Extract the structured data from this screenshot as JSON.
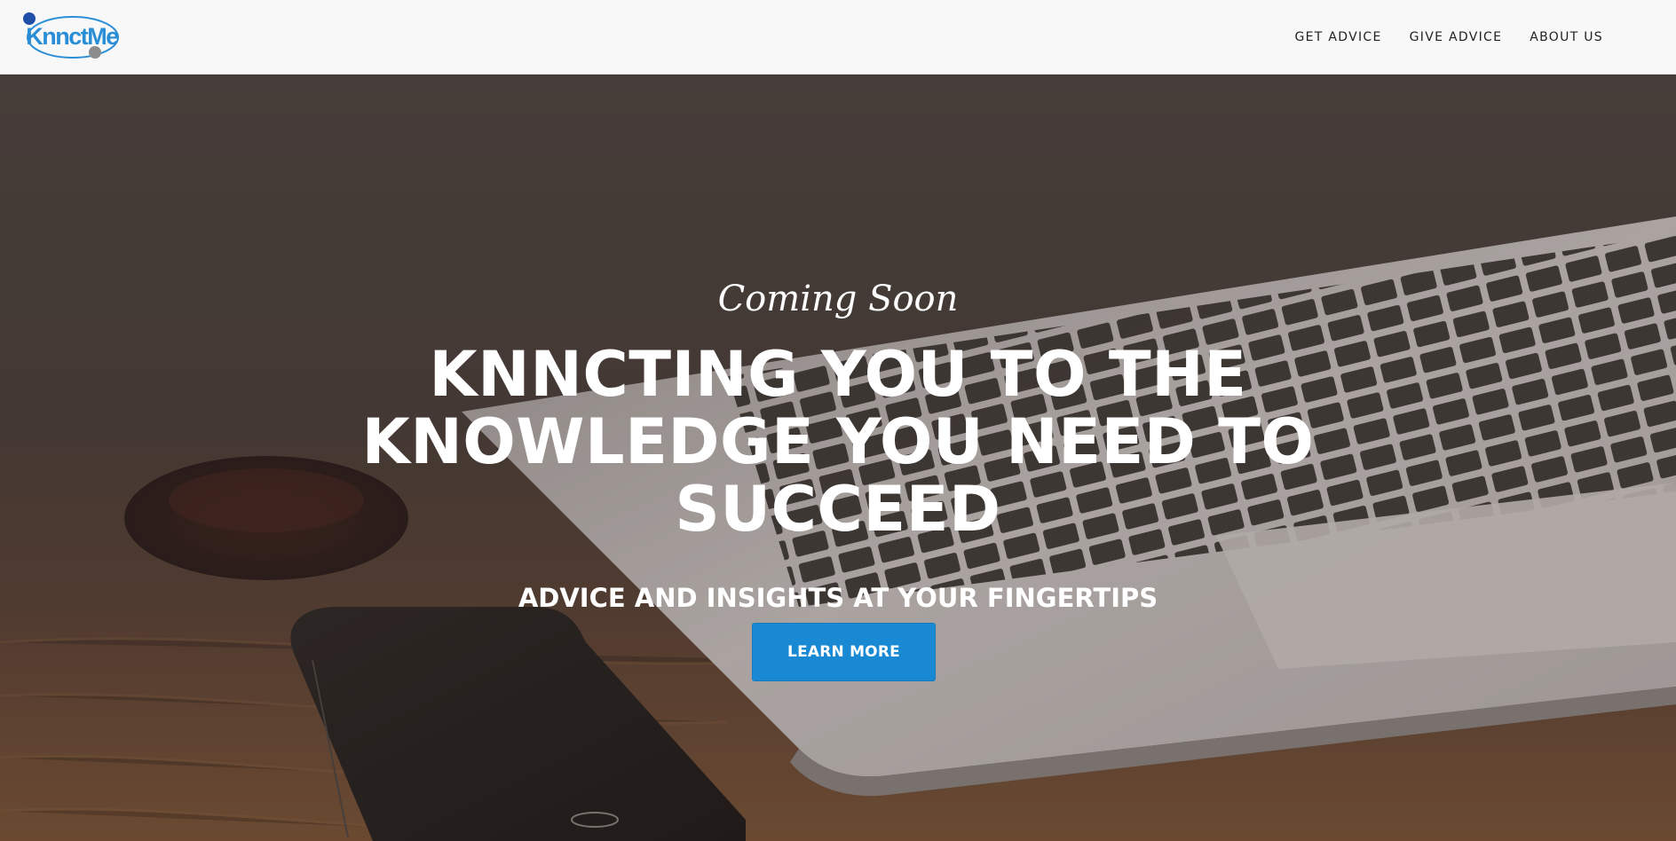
{
  "brand": {
    "logo_text": "KnnctMe",
    "logo_color": "#2a8ed6",
    "dot_primary_color": "#1f4fa6",
    "dot_secondary_color": "#8c8c8c"
  },
  "nav": {
    "items": [
      {
        "label": "GET ADVICE"
      },
      {
        "label": "GIVE ADVICE"
      },
      {
        "label": "ABOUT US"
      }
    ]
  },
  "hero": {
    "tagline": "Coming Soon",
    "headline": "KNNCTING YOU TO THE KNOWLEDGE YOU NEED TO SUCCEED",
    "subheading": "ADVICE AND INSIGHTS AT YOUR FINGERTIPS",
    "cta_label": "LEARN MORE",
    "cta_color": "#1889d2",
    "background_icons": [
      "laptop-image",
      "smartphone-image",
      "coffee-mug-image"
    ]
  }
}
